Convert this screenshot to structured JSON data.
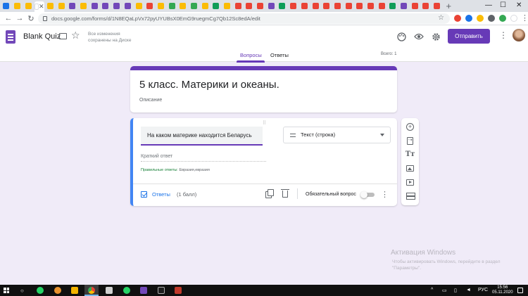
{
  "browser": {
    "url": "docs.google.com/forms/d/1N8EQaLpVx72pyUYUBsX0EmG9ruegmCg7Qb12Sc8edA/edit",
    "tab_colors": [
      "#1a73e8",
      "#fbbc04",
      "#fbbc04",
      "#ffffff",
      "#fbbc04",
      "#fbbc04",
      "#7248b9",
      "#fbbc04",
      "#7248b9",
      "#7248b9",
      "#7248b9",
      "#7248b9",
      "#fbbc04",
      "#ea4335",
      "#fbbc04",
      "#34a853",
      "#fbbc04",
      "#34a853",
      "#fbbc04",
      "#0f9d58",
      "#fbbc04",
      "#ea4335",
      "#ea4335",
      "#ea4335",
      "#7248b9",
      "#0f9d58",
      "#ea4335",
      "#ea4335",
      "#ea4335",
      "#ea4335",
      "#ea4335",
      "#ea4335",
      "#ea4335",
      "#ea4335",
      "#ea4335",
      "#0f9d58",
      "#7248b9",
      "#ea4335",
      "#ea4335",
      "#ea4335"
    ],
    "new_tab": "+",
    "win_min": "—",
    "win_max": "☐",
    "win_close": "✕",
    "tab_close": "✕"
  },
  "header": {
    "doc_title": "Blank Quiz",
    "saved_status": "Все изменения сохранены на Диске",
    "send_label": "Отправить",
    "more": "⋮"
  },
  "tabs": {
    "questions": "Вопросы",
    "responses": "Ответы",
    "total": "Всего: 1"
  },
  "form": {
    "title": "5 класс. Материки и океаны.",
    "description": "Описание"
  },
  "question": {
    "drag_handle": "⠿",
    "text": "На каком материке находится Беларусь",
    "type": "Текст (строка)",
    "short_answer_placeholder": "Краткий ответ",
    "correct_label": "Правильные ответы:",
    "correct_values": "Евразия,евразия",
    "answers_label": "Ответы",
    "points": "(1 балл)",
    "required_label": "Обязательный вопрос",
    "more": "⋮"
  },
  "toolbar": {
    "add": "+",
    "import": "⇢",
    "title": "Tт"
  },
  "watermark": {
    "title": "Активация Windows",
    "subtitle": "Чтобы активировать Windows, перейдите в раздел \"Параметры\"."
  },
  "taskbar": {
    "language": "РУС",
    "time": "15:56",
    "date": "05.11.2020"
  }
}
